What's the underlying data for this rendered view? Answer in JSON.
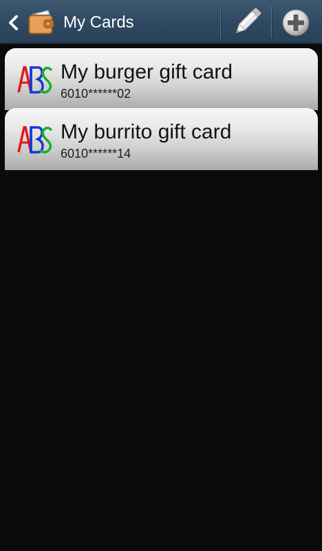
{
  "action_bar": {
    "title": "My Cards",
    "back_icon": "chevron-left-icon",
    "app_icon": "wallet-icon",
    "edit_icon": "pencil-icon",
    "add_icon": "plus-circle-icon"
  },
  "cards": [
    {
      "name": "My burger gift card",
      "number": "6010******02",
      "logo": "abs-logo"
    },
    {
      "name": "My burrito gift card",
      "number": "6010******14",
      "logo": "abs-logo"
    }
  ],
  "colors": {
    "action_bar": "#2f4a62",
    "background": "#0a0a0a",
    "logo_red": "#e01818",
    "logo_blue": "#1836d8",
    "logo_green": "#14b030"
  }
}
